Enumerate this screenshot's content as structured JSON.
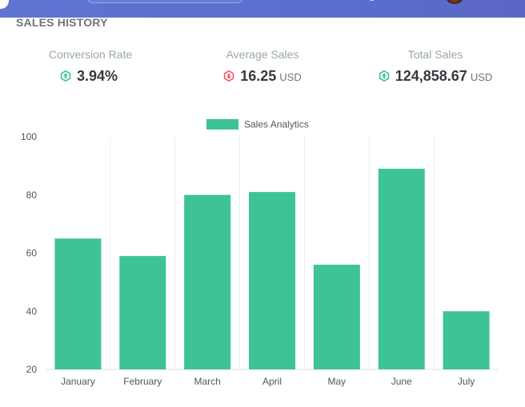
{
  "header": {
    "title": "SALES HISTORY"
  },
  "stats": [
    {
      "label": "Conversion Rate",
      "value": "3.94%",
      "unit": "",
      "trend": "up",
      "icon": "arrow-up-circle-icon"
    },
    {
      "label": "Average Sales",
      "value": "16.25",
      "unit": "USD",
      "trend": "down",
      "icon": "arrow-down-circle-icon"
    },
    {
      "label": "Total Sales",
      "value": "124,858.67",
      "unit": "USD",
      "trend": "up",
      "icon": "arrow-up-circle-icon"
    }
  ],
  "colors": {
    "up": "#3ec396",
    "down": "#f05b6e",
    "bar": "#3ec396",
    "grid": "#e9ecef"
  },
  "chart_data": {
    "type": "bar",
    "categories": [
      "January",
      "February",
      "March",
      "April",
      "May",
      "June",
      "July"
    ],
    "series": [
      {
        "name": "Sales Analytics",
        "values": [
          65,
          59,
          80,
          81,
          56,
          89,
          40
        ]
      }
    ],
    "ylim": [
      20,
      100
    ],
    "yticks": [
      20,
      40,
      60,
      80,
      100
    ],
    "legend": "top-center",
    "grid": true
  }
}
